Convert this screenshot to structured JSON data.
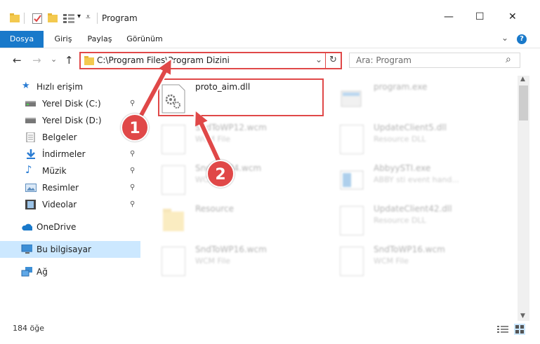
{
  "window": {
    "title": "Program",
    "controls": {
      "minimize": "—",
      "maximize": "☐",
      "close": "✕"
    }
  },
  "ribbon": {
    "tabs": [
      {
        "label": "Dosya"
      },
      {
        "label": "Giriş"
      },
      {
        "label": "Paylaş"
      },
      {
        "label": "Görünüm"
      }
    ],
    "help": "?",
    "chevron": "⌄"
  },
  "nav": {
    "back": "←",
    "forward": "→",
    "history": "⌄",
    "up": "↑"
  },
  "address": {
    "path": "C:\\Program Files\\Program Dizini",
    "dropdown": "⌄",
    "refresh": "↻"
  },
  "search": {
    "placeholder": "Ara: Program",
    "icon": "⌕"
  },
  "sidebar": {
    "quick_access": "Hızlı erişim",
    "items": [
      {
        "label": "Yerel Disk (C:)",
        "icon": "drive-icon",
        "pinned": true
      },
      {
        "label": "Yerel Disk (D:)",
        "icon": "drive-icon",
        "pinned": true
      },
      {
        "label": "Belgeler",
        "icon": "documents-icon",
        "pinned": true
      },
      {
        "label": "İndirmeler",
        "icon": "downloads-icon",
        "pinned": true
      },
      {
        "label": "Müzik",
        "icon": "music-icon",
        "pinned": true
      },
      {
        "label": "Resimler",
        "icon": "pictures-icon",
        "pinned": true
      },
      {
        "label": "Videolar",
        "icon": "videos-icon",
        "pinned": true
      }
    ],
    "onedrive": "OneDrive",
    "this_pc": "Bu bilgisayar",
    "network": "Ağ",
    "pin_glyph": "📌"
  },
  "files": {
    "highlighted": {
      "name": "proto_aim.dll"
    },
    "items": [
      {
        "name": "program.exe",
        "sub": ""
      },
      {
        "name": "SndToWP12.wcm",
        "sub": "WCM File"
      },
      {
        "name": "UpdateClient5.dll",
        "sub": "Resource DLL"
      },
      {
        "name": "SndToWP4.wcm",
        "sub": "WCM File"
      },
      {
        "name": "AbbyySTI.exe",
        "sub": "ABBY sti event hand..."
      },
      {
        "name": "Resource",
        "sub": ""
      },
      {
        "name": "UpdateClient42.dll",
        "sub": "Resource DLL"
      },
      {
        "name": "SndToWP16.wcm",
        "sub": "WCM File"
      },
      {
        "name": "SndToWP16.wcm",
        "sub": "WCM File"
      }
    ]
  },
  "callouts": {
    "one": "1",
    "two": "2"
  },
  "status": {
    "count": "184 öğe"
  },
  "colors": {
    "accent": "#1979ca",
    "highlight": "#e04848",
    "selected_bg": "#cce8ff"
  }
}
